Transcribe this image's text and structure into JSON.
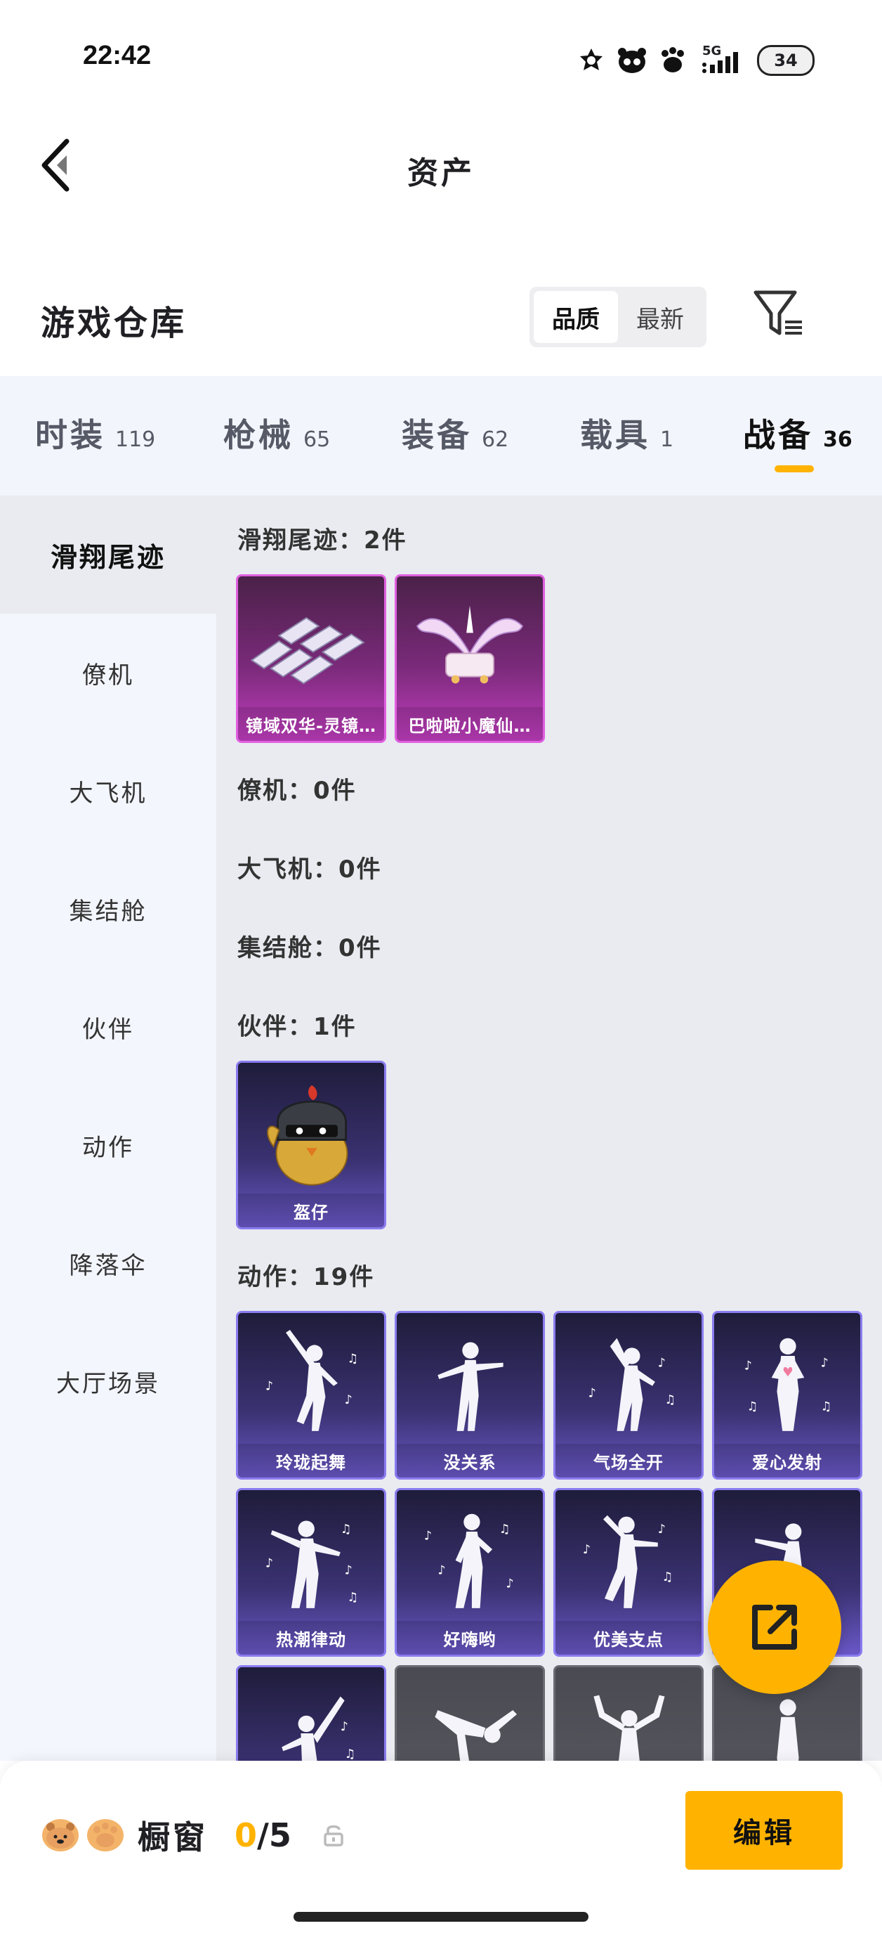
{
  "status_bar": {
    "time": "22:42",
    "network": "5G",
    "battery": "34"
  },
  "header": {
    "title": "资产"
  },
  "warehouse": {
    "title": "游戏仓库",
    "sort_options": [
      "品质",
      "最新"
    ],
    "selected_sort": "品质"
  },
  "tabs": [
    {
      "label": "时装",
      "count": "119"
    },
    {
      "label": "枪械",
      "count": "65"
    },
    {
      "label": "装备",
      "count": "62"
    },
    {
      "label": "载具",
      "count": "1"
    },
    {
      "label": "战备",
      "count": "36"
    }
  ],
  "active_tab": "战备",
  "sidebar": {
    "items": [
      "滑翔尾迹",
      "僚机",
      "大飞机",
      "集结舱",
      "伙伴",
      "动作",
      "降落伞",
      "大厅场景"
    ],
    "active": "滑翔尾迹"
  },
  "sections": {
    "glide_trail": {
      "heading": "滑翔尾迹：2件",
      "items": [
        "镜域双华-灵镜…",
        "巴啦啦小魔仙…"
      ]
    },
    "wingman": {
      "heading": "僚机：0件"
    },
    "big_plane": {
      "heading": "大飞机：0件"
    },
    "rally_pod": {
      "heading": "集结舱：0件"
    },
    "partner": {
      "heading": "伙伴：1件",
      "items": [
        "盔仔"
      ]
    },
    "emote": {
      "heading": "动作：19件",
      "items": [
        "玲珑起舞",
        "没关系",
        "气场全开",
        "爱心发射",
        "热潮律动",
        "好嗨哟",
        "优美支点"
      ]
    }
  },
  "bottom_bar": {
    "showcase_label": "橱窗",
    "showcase_current": "0",
    "showcase_total": "/5",
    "edit_label": "编辑"
  },
  "colors": {
    "accent": "#ffb300",
    "purple_card": "#c23ec0",
    "blue_card": "#6a58c8"
  }
}
